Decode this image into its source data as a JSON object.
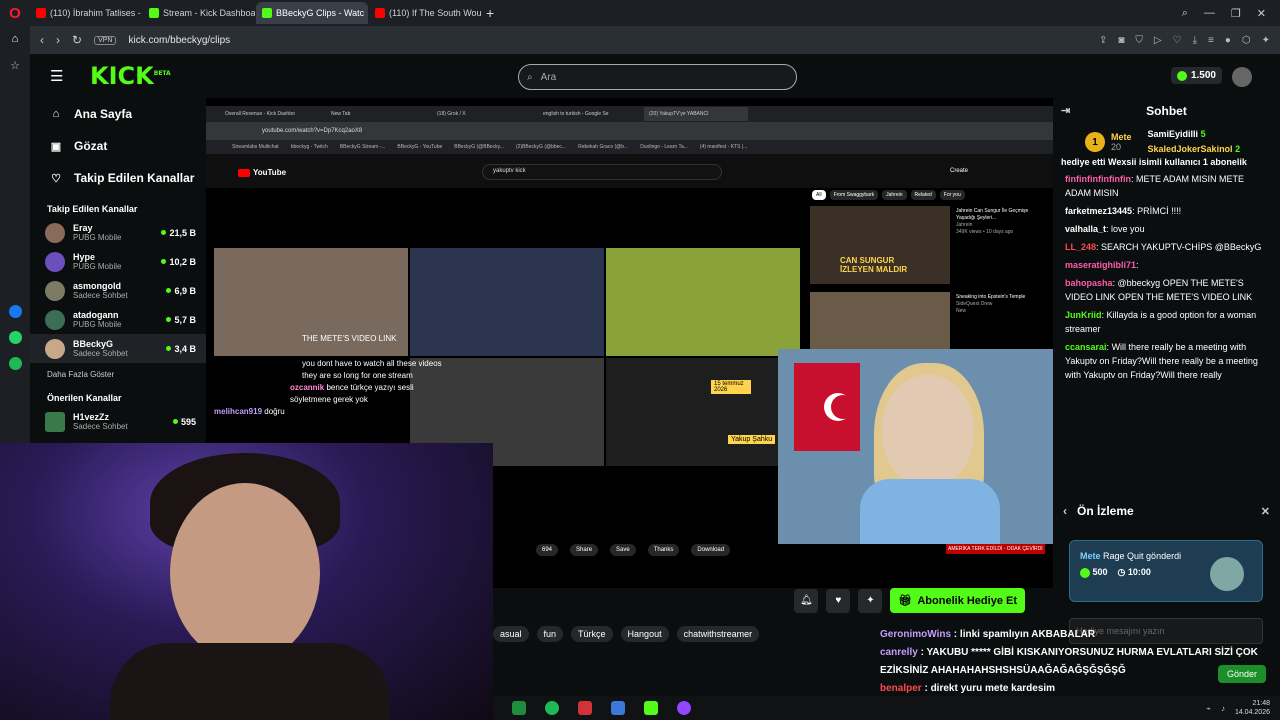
{
  "browser": {
    "tabs": [
      {
        "label": "(110) İbrahim Tatlises - Sa",
        "icon": "youtube-icon",
        "active": false
      },
      {
        "label": "Stream - Kick Dashboard",
        "icon": "kick-icon",
        "active": false
      },
      {
        "label": "BBeckyG Clips - Watc",
        "icon": "kick-icon",
        "active": true
      },
      {
        "label": "(110) If The South Woulda",
        "icon": "youtube-icon",
        "active": false
      }
    ],
    "vpn_label": "VPN",
    "url": "kick.com/bbeckyg/clips"
  },
  "kick": {
    "logo": "KICK",
    "logo_sup": "BETA",
    "search_placeholder": "Ara",
    "coins": "1.500",
    "main_nav": [
      {
        "label": "Ana Sayfa",
        "icon": "home-icon"
      },
      {
        "label": "Gözat",
        "icon": "browse-icon"
      },
      {
        "label": "Takip Edilen Kanallar",
        "icon": "heart-icon"
      }
    ],
    "followed_title": "Takip Edilen Kanallar",
    "followed": [
      {
        "name": "Eray",
        "game": "PUBG Mobile",
        "viewers": "21,5 B"
      },
      {
        "name": "Hype",
        "game": "PUBG Mobile",
        "viewers": "10,2 B"
      },
      {
        "name": "asmongold",
        "game": "Sadece Sohbet",
        "viewers": "6,9 B"
      },
      {
        "name": "atadogann",
        "game": "PUBG Mobile",
        "viewers": "5,7 B"
      },
      {
        "name": "BBeckyG",
        "game": "Sadece Sohbet",
        "viewers": "3,4 B"
      }
    ],
    "show_more": "Daha Fazla Göster",
    "recommended_title": "Önerilen Kanallar",
    "recommended": [
      {
        "name": "H1vezZz",
        "game": "Sadece Sohbet",
        "viewers": "595"
      }
    ],
    "tags": [
      "asual",
      "fun",
      "Türkçe",
      "Hangout",
      "chatwithstreamer"
    ],
    "subscribe_label": "Abonelik Hediye Et"
  },
  "stream_content": {
    "inner_tabs": [
      "Overall Revenue - Kick Dashbo",
      "New Tab",
      "(18) Grok / X",
      "english to turkish - Google Se",
      "(20) YakupTV'ye YABANCI"
    ],
    "inner_url": "youtube.com/watch?v=Dp7Kcq2aoX8",
    "bookmarks": [
      "Streamlabs Multichat",
      "bbeckyg - Twitch",
      "BBeckyG Stream -...",
      "BBeckyG - YouTube",
      "BBeckyG (@BBecky...",
      "(2)BBeckyG (@bbec...",
      "Rebekah Graco (@b...",
      "Duolingo - Learn Ta...",
      "(4) manifest - KTS |..."
    ],
    "yt_search": "yakuptv kick",
    "yt_logo": "YouTube",
    "yt_create": "Create",
    "chips": [
      "All",
      "From Swaggybark",
      "Jahrein",
      "Related",
      "For you"
    ],
    "side_videos": [
      {
        "title": "Jahrein Can Sungur İle Geçmişe Yaşadığı Şeyleri...",
        "channel": "Jahrein",
        "meta": "349K views • 10 days ago"
      },
      {
        "title": "Sneaking into Epstein's Temple",
        "channel": "SideQuest Drew",
        "meta": "New"
      }
    ],
    "thumb_caption": "CAN SUNGUR İZLEYEN MALDIR",
    "mete_link": "THE METE'S VIDEO LINK",
    "overlay_lines": [
      {
        "user": "",
        "text": "you dont have to watch all these videos they are so long for one stream"
      },
      {
        "user": "ozcannik",
        "text": "bence türkçe yazıyı sesli söyletmene gerek yok"
      },
      {
        "user": "melihcan919",
        "text": "doğru"
      }
    ],
    "date_badge": "15 temmuz 2026",
    "yakup_label": "Yakup Şahku",
    "actions": [
      "694",
      "Share",
      "Save",
      "Thanks",
      "Download"
    ],
    "bottom_banner": "AMERİKA TERK EDİLDİ - ODAK ÇEVİRDİ"
  },
  "chat": {
    "title": "Sohbet",
    "leaderboard": {
      "rank": "1",
      "top_name": "Mete",
      "top_count": "20",
      "users": [
        {
          "name": "SamiEyidilli",
          "count": "5"
        },
        {
          "name": "SkaledJokerSakinol",
          "count": "2"
        }
      ]
    },
    "gift_banner": "hediye etti  Wexsii isimli kullanıcı 1 abonelik",
    "messages": [
      {
        "user": "finfinfinfinfinfin",
        "class": "u-pink",
        "text": "METE ADAM MISIN METE ADAM MISIN"
      },
      {
        "user": "farketmez13445",
        "class": "u-white",
        "text": "PRİMCİ !!!!"
      },
      {
        "user": "valhalla_t",
        "class": "u-white",
        "text": "love you"
      },
      {
        "user": "LL_248",
        "class": "u-red",
        "text": "SEARCH YAKUPTV-CHİPS @BBeckyG"
      },
      {
        "user": "maseratighibli71",
        "class": "u-pink",
        "text": ""
      },
      {
        "user": "bahopasha",
        "class": "u-pink",
        "text": "@bbeckyg OPEN THE METE'S VIDEO LINK OPEN THE METE'S VIDEO LINK"
      },
      {
        "user": "JunKriid",
        "class": "u-green",
        "text": "Killayda is a good option for a woman streamer"
      },
      {
        "user": "ccansarai",
        "class": "u-green",
        "text": "Will there really be a meeting with Yakuptv on Friday?Will there really be a meeting with Yakuptv on Friday?Will there really"
      }
    ],
    "preview": {
      "title": "Ön İzleme",
      "sender": "Mete",
      "action": "Rage Quit gönderdi",
      "cost": "500",
      "duration": "10:00",
      "input_placeholder": "Hediye mesajını yazın",
      "send_label": "Gönder"
    }
  },
  "overlay_chat": [
    {
      "user": "GeronimoWins",
      "class": "u-purple",
      "text": "linki spamlıyın AKBABALAR"
    },
    {
      "user": "canrelly",
      "class": "u-purple",
      "text": "YAKUBU ***** GİBİ KISKANIYORSUNUZ HURMA EVLATLARI SİZİ ÇOK"
    },
    {
      "user": "",
      "class": "",
      "text": "EZİKSİNİZ AHAHAHAHSHSHSÜAAĞAĞAĞŞĞŞĞŞĞ"
    },
    {
      "user": "benalper",
      "class": "u-red",
      "text": "direkt yuru mete kardesim"
    },
    {
      "user": "benalper",
      "class": "u-red",
      "text": ""
    }
  ],
  "taskbar": {
    "time": "21:48",
    "date": "14.04.2026"
  }
}
